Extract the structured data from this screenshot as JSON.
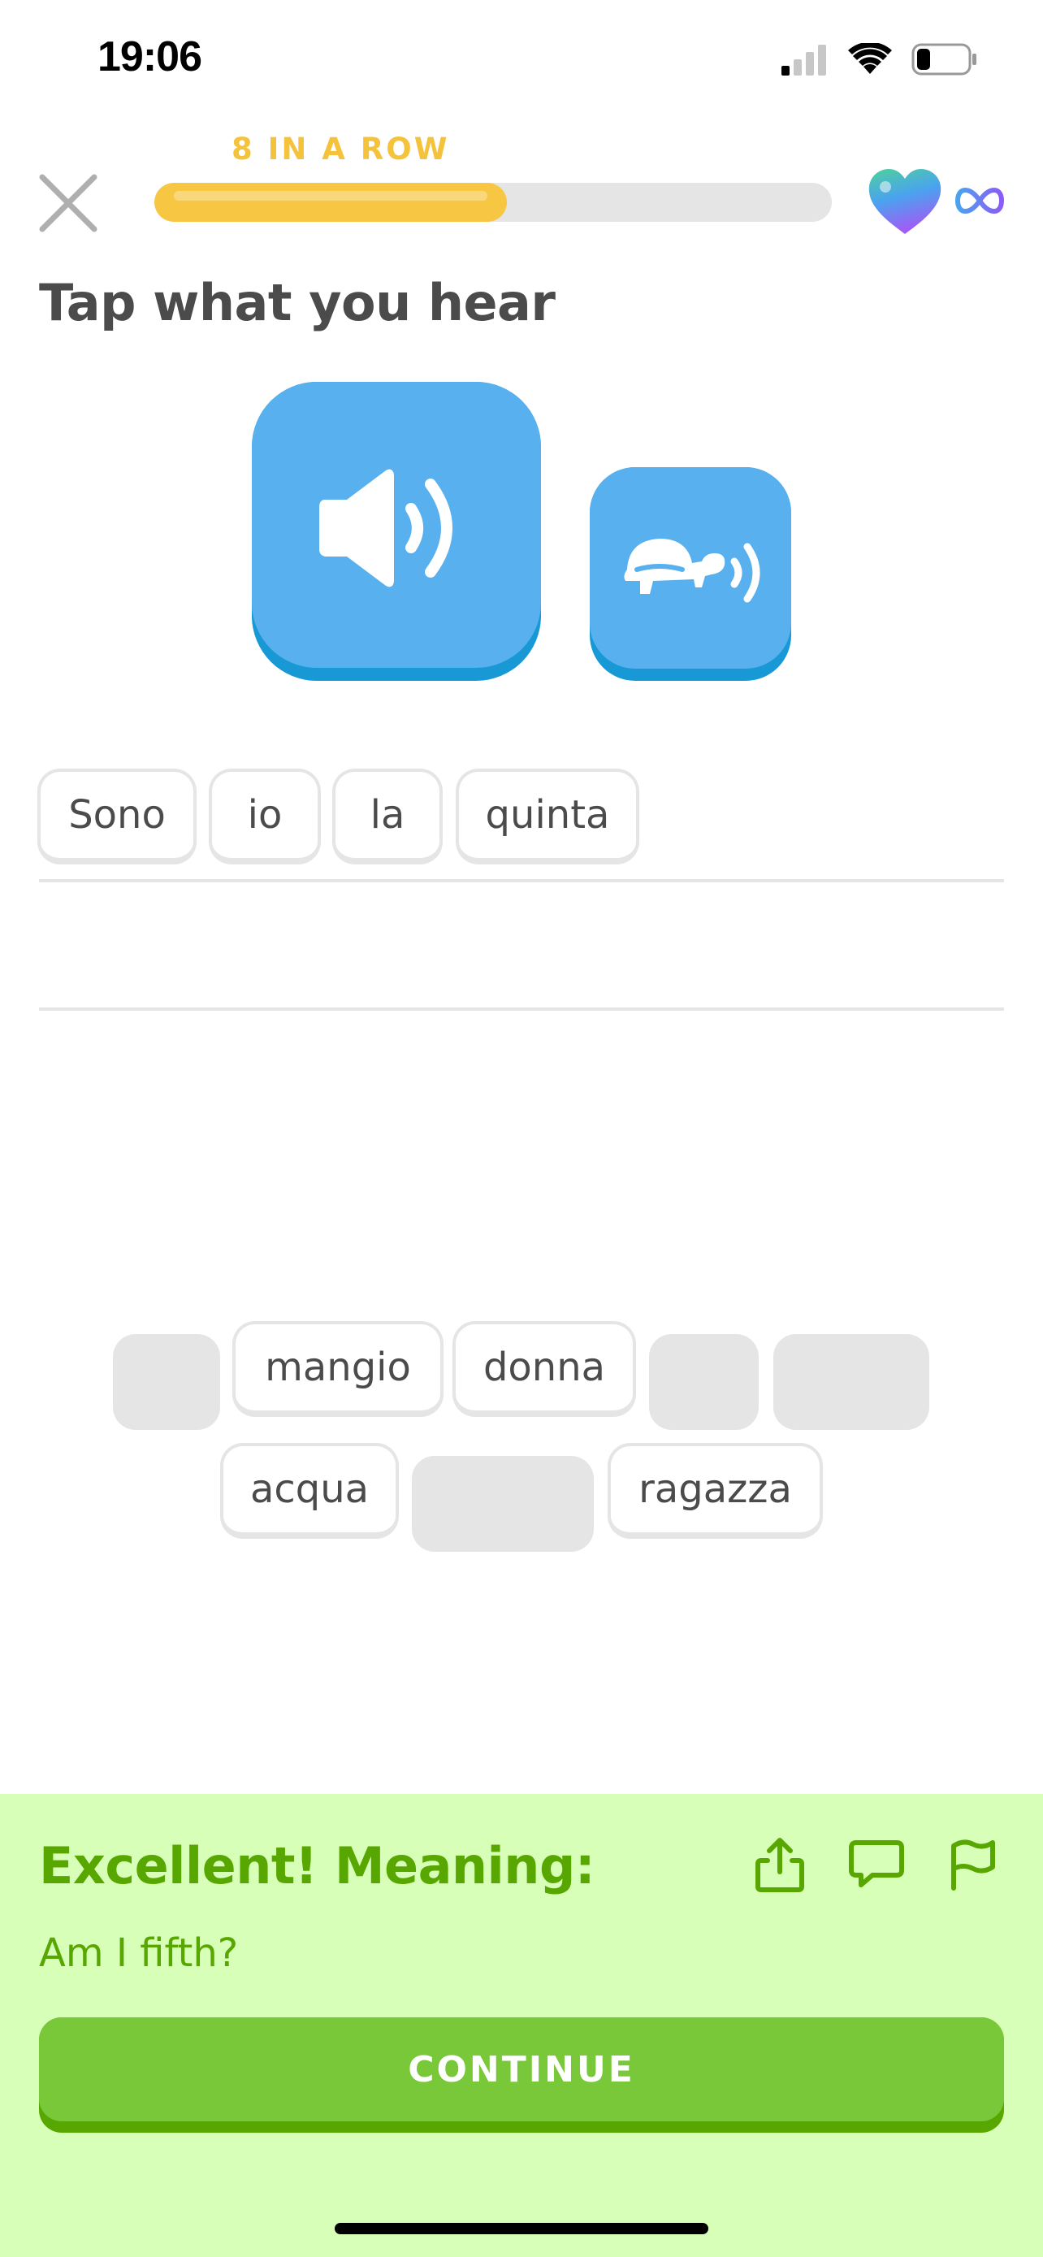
{
  "status_bar": {
    "time": "19:06",
    "icons": [
      "cellular-signal-icon",
      "wifi-icon",
      "battery-icon"
    ]
  },
  "header": {
    "close_icon": "close-icon",
    "streak_label": "8 IN A ROW",
    "progress_fraction": 0.52,
    "hearts_icon": "heart-icon",
    "hearts_count_icon": "infinity-icon"
  },
  "prompt": {
    "title": "Tap what you hear",
    "audio_button_icon": "speaker-icon",
    "slow_audio_button_icon": "turtle-speaker-icon"
  },
  "answer": {
    "selected_words": [
      "Sono",
      "io",
      "la",
      "quinta"
    ]
  },
  "word_bank": {
    "row1": [
      "",
      "mangio",
      "donna",
      "",
      ""
    ],
    "row2": [
      "acqua",
      "",
      "ragazza"
    ]
  },
  "feedback": {
    "title": "Excellent! Meaning:",
    "meaning": "Am I fifth?",
    "icons": [
      "share-icon",
      "comment-icon",
      "report-flag-icon"
    ],
    "continue_label": "CONTINUE"
  },
  "colors": {
    "streak": "#f4c33b",
    "progress": "#f7c744",
    "audio_button": "#58b0ef",
    "feedback_bg": "#d7ffb8",
    "feedback_text": "#58a700",
    "continue_button": "#78c83a"
  }
}
